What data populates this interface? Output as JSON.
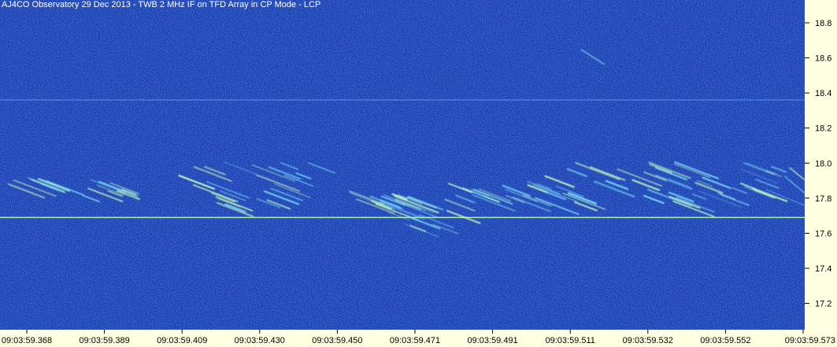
{
  "chart_data": {
    "type": "heatmap",
    "title": "AJ4CO Observatory 29 Dec 2013 - TWB 2 MHz IF on TFD Array in CP Mode - LCP",
    "xlabel": "",
    "ylabel": "",
    "x_tick_labels": [
      "09:03:59.368",
      "09:03:59.389",
      "09:03:59.409",
      "09:03:59.430",
      "09:03:59.450",
      "09:03:59.471",
      "09:03:59.491",
      "09:03:59.511",
      "09:03:59.532",
      "09:03:59.552",
      "09:03:59.573"
    ],
    "y_ticks": [
      17.2,
      17.4,
      17.6,
      17.8,
      18.0,
      18.2,
      18.4,
      18.6,
      18.8
    ],
    "y_tick_labels": [
      "17.2",
      "17.4",
      "17.6",
      "17.8",
      "18.0",
      "18.2",
      "18.4",
      "18.6",
      "18.8"
    ],
    "ylim": [
      17.05,
      18.93
    ],
    "y_axis_side": "right",
    "grid": false,
    "colors": {
      "background": "#1a3fb0",
      "noise_dark": "#0f2a8a",
      "noise_light": "#2f6ad8",
      "burst": "#b8ffb0",
      "axis_bg": "#ffffe1"
    },
    "interference_lines_mhz": [
      17.69,
      18.36
    ]
  }
}
